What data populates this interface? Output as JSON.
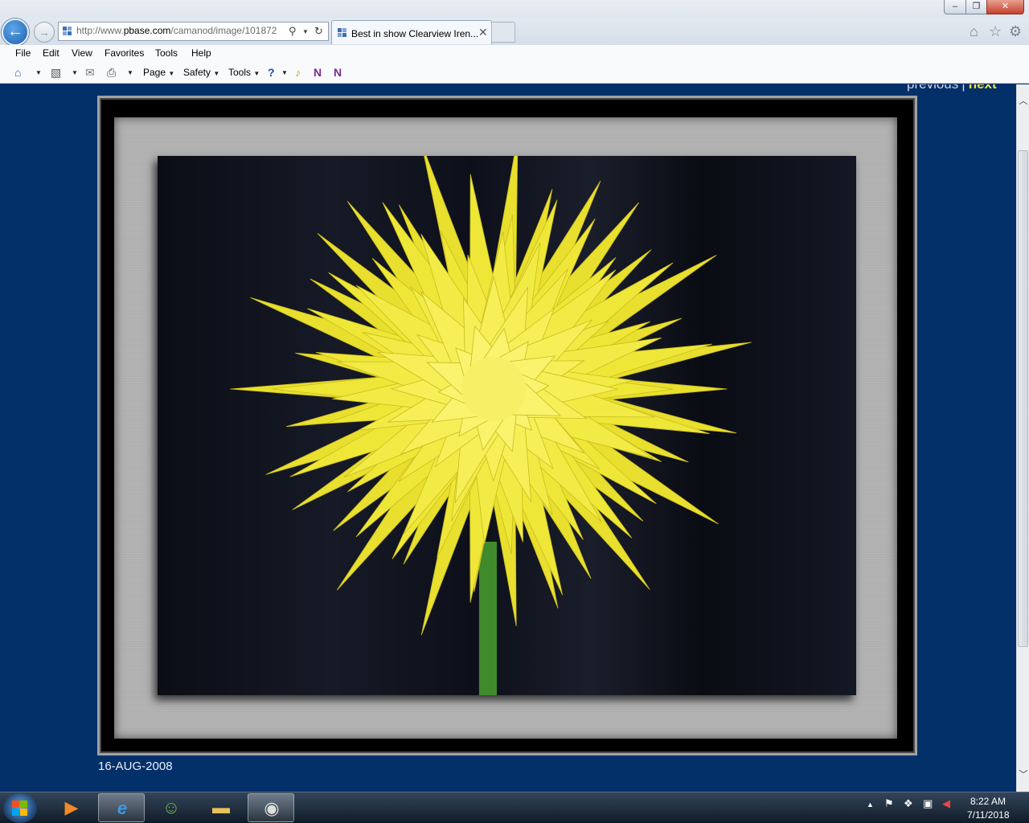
{
  "browser": {
    "address_url": "http://www.pbase.com/camanod/image/101872",
    "url_domain": "pbase.com",
    "tab_title": "Best in show Clearview Iren...",
    "tab_close": "✕",
    "window_buttons": {
      "minimize": "–",
      "maximize": "❐",
      "close": "✕"
    }
  },
  "menu": {
    "items": [
      "File",
      "Edit",
      "View",
      "Favorites",
      "Tools",
      "Help"
    ]
  },
  "commandbar": {
    "page_label": "Page",
    "safety_label": "Safety",
    "tools_label": "Tools"
  },
  "page": {
    "pager_previous": "previous",
    "pager_separator": "|",
    "pager_next": "next",
    "photo_date": "16-AUG-2008"
  },
  "taskbar": {
    "clock_time": "8:22 AM",
    "clock_date": "7/11/2018"
  },
  "colors": {
    "page_background": "#04306a",
    "petal_yellow": "#f1ea3d",
    "next_link": "#f3e340"
  },
  "icons": [
    "back-arrow-icon",
    "forward-arrow-icon",
    "search-icon",
    "refresh-icon",
    "home-icon",
    "star-icon",
    "gear-icon",
    "rss-icon",
    "mail-icon",
    "print-icon",
    "help-icon",
    "onenote-icon"
  ]
}
